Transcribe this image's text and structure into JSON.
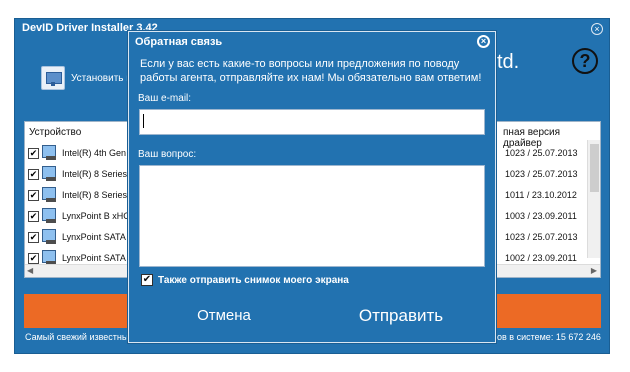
{
  "main": {
    "title": "DevID Driver Installer 3.42",
    "close_glyph": "×",
    "install_label": "Установить в",
    "brand_text": "td.",
    "help_glyph": "?",
    "table": {
      "col_device": "Устройство",
      "col_version": "пная версия драйвер",
      "rows": [
        {
          "device": "Intel(R) 4th Gen C",
          "version": "1023 / 25.07.2013"
        },
        {
          "device": "Intel(R) 8 Series/",
          "version": "1023 / 25.07.2013"
        },
        {
          "device": "Intel(R) 8 Series/",
          "version": "1011 / 23.10.2012"
        },
        {
          "device": "LynxPoint B xHCI",
          "version": "1003 / 23.09.2011"
        },
        {
          "device": "LynxPoint SATA C",
          "version": "1023 / 25.07.2013"
        },
        {
          "device": "LynxPoint SATA C",
          "version": "1002 / 23.09.2011"
        }
      ]
    },
    "footer_left": "Самый свежий известны",
    "footer_right": "ов в системе: 15 672 246",
    "accent_color": "#2272b0",
    "orange_color": "#ec6a25"
  },
  "dialog": {
    "title": "Обратная связь",
    "close_glyph": "×",
    "message": "Если у вас есть какие-то вопросы или предложения по поводу работы агента, отправляйте их нам! Мы обязательно вам ответим!",
    "email_label": "Ваш e-mail:",
    "email_value": "",
    "question_label": "Ваш вопрос:",
    "question_value": "",
    "screenshot_check_label": "Также отправить снимок моего экрана",
    "screenshot_checked": true,
    "check_glyph": "✔",
    "cancel_label": "Отмена",
    "send_label": "Отправить"
  }
}
